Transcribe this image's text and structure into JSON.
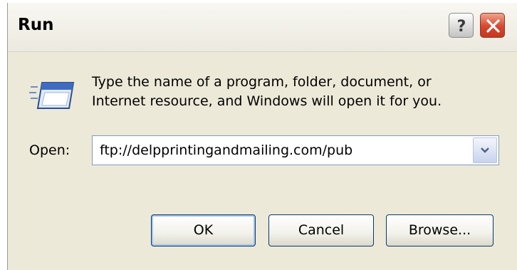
{
  "window": {
    "title": "Run",
    "help_label": "?",
    "close_label": "X"
  },
  "icon": "run-program-icon",
  "description": {
    "line1": "Type the name of a program, folder, document, or",
    "line2": "Internet resource, and Windows will open it for you."
  },
  "open_field": {
    "label": "Open:",
    "value": "ftp://delpprintingandmailing.com/pub"
  },
  "buttons": {
    "ok": "OK",
    "cancel": "Cancel",
    "browse": "Browse..."
  },
  "colors": {
    "dialog_bg": "#ece9d8",
    "close_button": "#d8462e",
    "input_border": "#7f9db9",
    "button_border": "#003c74"
  }
}
